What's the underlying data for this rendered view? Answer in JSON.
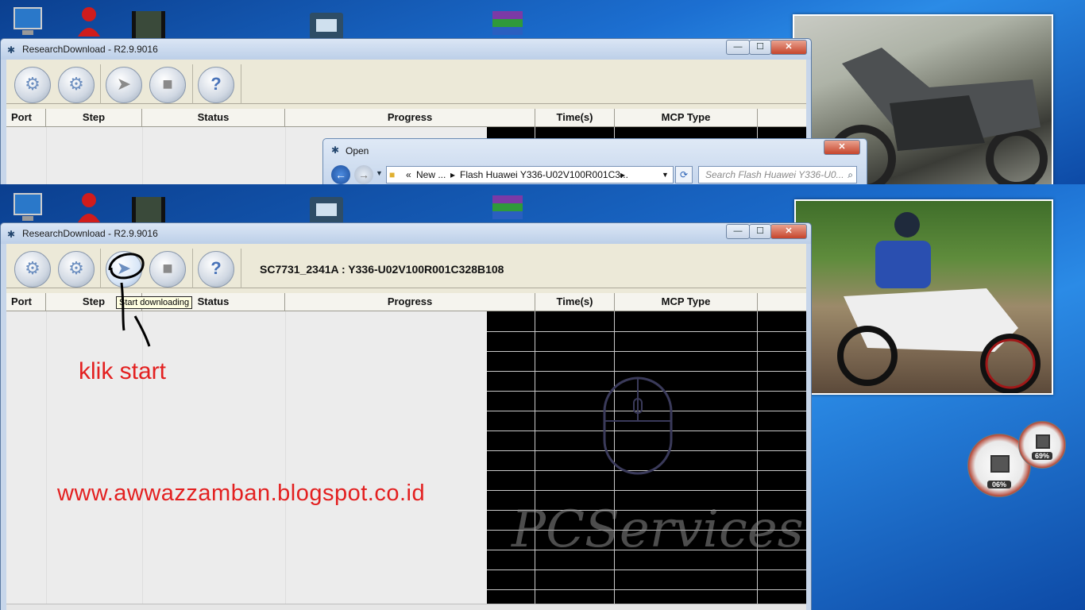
{
  "top_panel": {
    "window": {
      "title": "ResearchDownload - R2.9.9016",
      "controls": {
        "minimize": "—",
        "maximize": "☐",
        "close": "✕"
      }
    },
    "columns": [
      "Port",
      "Step",
      "Status",
      "Progress",
      "Time(s)",
      "MCP Type"
    ],
    "open_dialog": {
      "title": "Open",
      "path_prefix": "«",
      "path_crumb_1": "New ...",
      "path_arrow": "▸",
      "path_crumb_2": "Flash Huawei Y336-U02V100R001C3...",
      "path_more": "▸",
      "search_placeholder": "Search Flash Huawei Y336-U0..."
    }
  },
  "bottom_panel": {
    "window": {
      "title": "ResearchDownload - R2.9.9016",
      "controls": {
        "minimize": "—",
        "maximize": "☐",
        "close": "✕"
      }
    },
    "firmware_label": "SC7731_2341A : Y336-U02V100R001C328B108",
    "columns": [
      "Port",
      "Step",
      "Status",
      "Progress",
      "Time(s)",
      "MCP Type"
    ],
    "tooltip": "Start downloading",
    "annotation_click": "klik start",
    "annotation_url": "www.awwazzamban.blogspot.co.id",
    "watermark": "PCServices",
    "gadgets": {
      "cpu_gauge": "06%",
      "memory_gauge": "69%"
    }
  },
  "toolbar_icons": [
    "settings-gear-icon",
    "settings-gears-icon",
    "start-play-icon",
    "stop-icon",
    "help-icon"
  ],
  "colors": {
    "desktop_blue": "#1565c0",
    "window_frame": "#c7d6ea",
    "client_bg": "#ece9d8",
    "annotation_red": "#e32020",
    "grid_black": "#000000"
  }
}
